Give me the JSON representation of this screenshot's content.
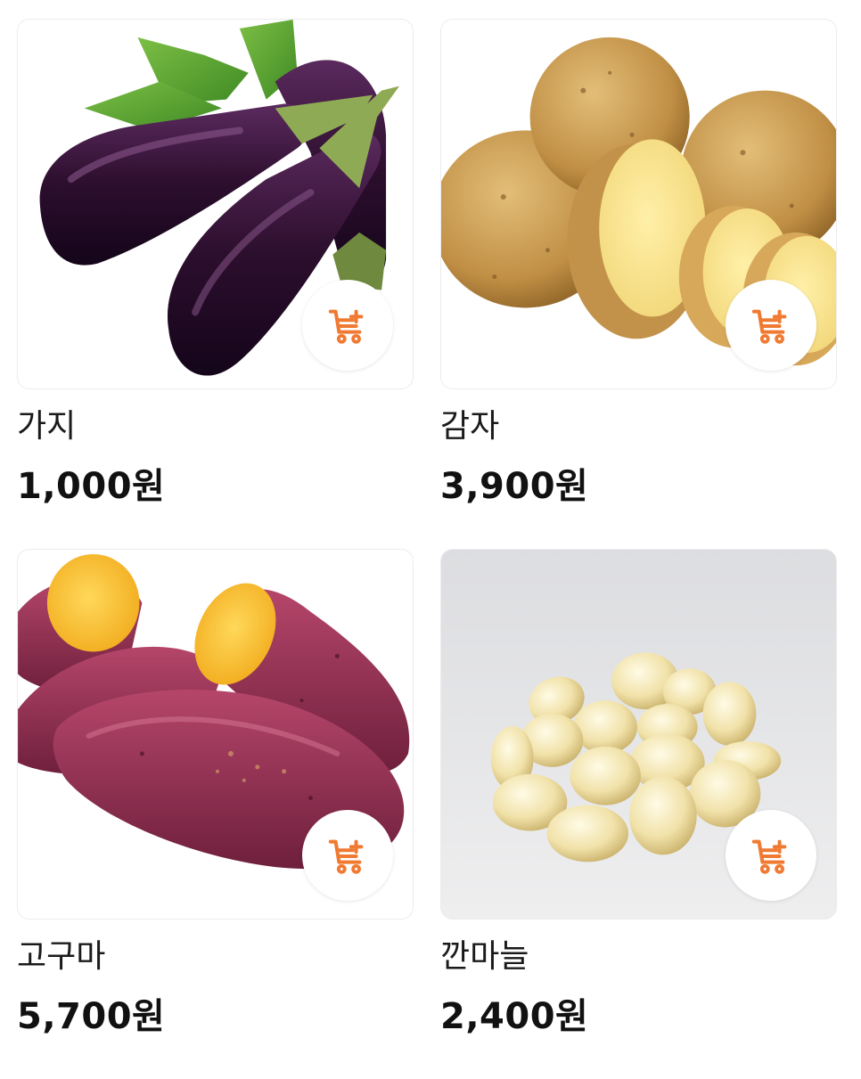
{
  "accent_color": "#f07a32",
  "products": [
    {
      "name": "가지",
      "price": "1,000원",
      "image_icon": "eggplant-image",
      "cart_icon": "cart-plus-icon"
    },
    {
      "name": "감자",
      "price": "3,900원",
      "image_icon": "potato-image",
      "cart_icon": "cart-plus-icon"
    },
    {
      "name": "고구마",
      "price": "5,700원",
      "image_icon": "sweet-potato-image",
      "cart_icon": "cart-plus-icon"
    },
    {
      "name": "깐마늘",
      "price": "2,400원",
      "image_icon": "peeled-garlic-image",
      "cart_icon": "cart-plus-icon"
    }
  ]
}
